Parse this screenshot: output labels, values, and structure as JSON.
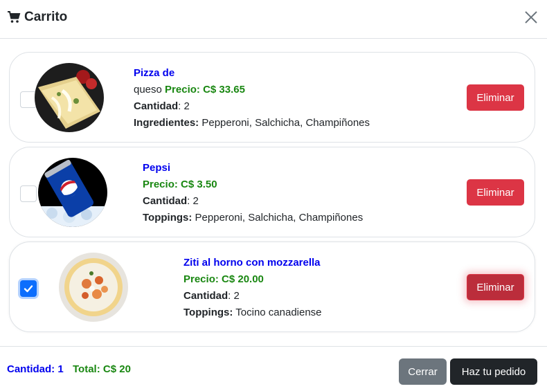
{
  "header": {
    "title": "Carrito"
  },
  "items": [
    {
      "name": "Pizza de",
      "name_cont": "queso",
      "price": "Precio: C$ 33.65",
      "qty_label": "Cantidad",
      "qty_value": ": 2",
      "extra_label": "Ingredientes:",
      "extra_value": " Pepperoni, Salchicha, Champiñones",
      "delete_label": "Eliminar",
      "checked": false
    },
    {
      "name": "Pepsi",
      "price": "Precio: C$ 3.50",
      "qty_label": "Cantidad",
      "qty_value": ": 2",
      "extra_label": "Toppings:",
      "extra_value": " Pepperoni, Salchicha, Champiñones",
      "delete_label": "Eliminar",
      "checked": false
    },
    {
      "name": "Ziti al horno con mozzarella",
      "price": "Precio: C$ 20.00",
      "qty_label": "Cantidad",
      "qty_value": ": 2",
      "extra_label": "Toppings:",
      "extra_value": " Tocino canadiense",
      "delete_label": "Eliminar",
      "checked": true
    }
  ],
  "footer": {
    "quantity": "Cantidad: 1",
    "total": "Total: C$ 20",
    "close_label": "Cerrar",
    "order_label": "Haz tu pedido"
  },
  "colors": {
    "name_blue": "#0000ee",
    "price_green": "#198711",
    "danger": "#dc3545",
    "secondary": "#6c757d",
    "dark": "#212529",
    "primary": "#0d6efd"
  }
}
